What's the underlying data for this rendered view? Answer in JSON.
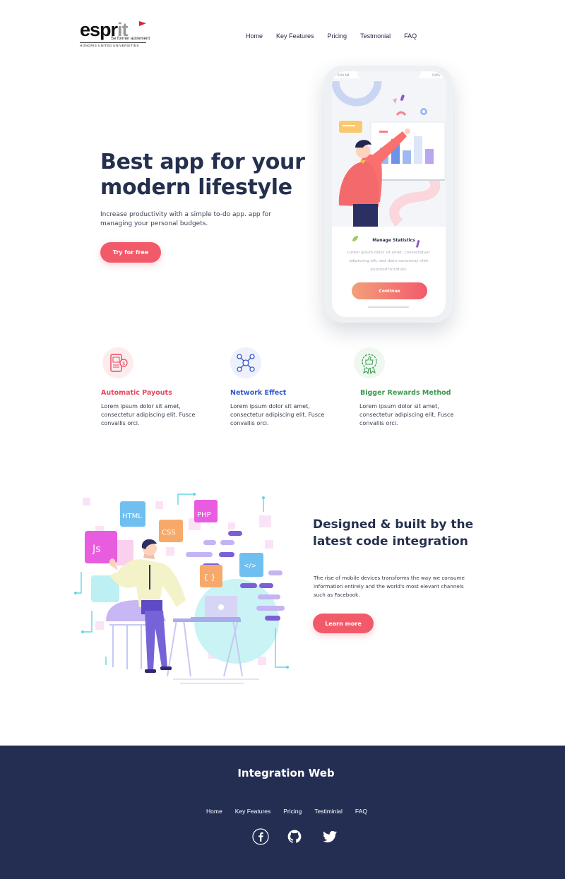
{
  "brand": {
    "logo_main_a": "espr",
    "logo_main_b": "it",
    "tagline": "Se former autrement",
    "sub": "HONORIS UNITED UNIVERSITIES"
  },
  "nav": {
    "items": [
      "Home",
      "Key Features",
      "Pricing",
      "Testmonial",
      "FAQ"
    ]
  },
  "hero": {
    "title": "Best app for your modern lifestyle",
    "description": "Increase productivity with a simple to-do app. app for managing your personal budgets.",
    "button": "Try for free"
  },
  "phone": {
    "time": "9:00 AM",
    "battery": "100%",
    "card_title": "Manage Statistics",
    "card_text": "Lorem ipsum dolor sit amet, consectetuer adipiscing elit, sed diam nonummy nibh euismod tincidunt.",
    "button": "Continue"
  },
  "features": [
    {
      "title": "Automatic Payouts",
      "text": "Lorem ipsum dolor sit amet, consectetur adipiscing elit. Fusce convallis orci.",
      "color": "#e8475c",
      "icon": "payout-icon"
    },
    {
      "title": "Network Effect",
      "text": "Lorem ipsum dolor sit amet, consectetur adipiscing elit. Fusce convallis orci.",
      "color": "#3358c9",
      "icon": "network-icon"
    },
    {
      "title": "Bigger Rewards Method",
      "text": "Lorem ipsum dolor sit amet, consectetur adipiscing elit. Fusce convallis orci.",
      "color": "#3d9a4f",
      "icon": "reward-badge-icon"
    }
  ],
  "integration": {
    "title": "Designed & built by the latest code integration",
    "description": "The rise of mobile devices transforms the way we consume information entirely and the world's most elevant channels such as Facebook.",
    "button": "Learn more",
    "tiles": {
      "html": "HTML",
      "css": "CSS",
      "php": "PHP",
      "js": "Js",
      "code": "</>",
      "braces": "{ }"
    }
  },
  "footer": {
    "title": "Integration Web",
    "nav": [
      "Home",
      "Key Features",
      "Pricing",
      "Testiminial",
      "FAQ"
    ],
    "social": [
      "facebook-icon",
      "github-icon",
      "twitter-icon"
    ]
  },
  "colors": {
    "accent": "#f25a6a",
    "navy": "#25304f",
    "footer_bg": "#242e52"
  }
}
